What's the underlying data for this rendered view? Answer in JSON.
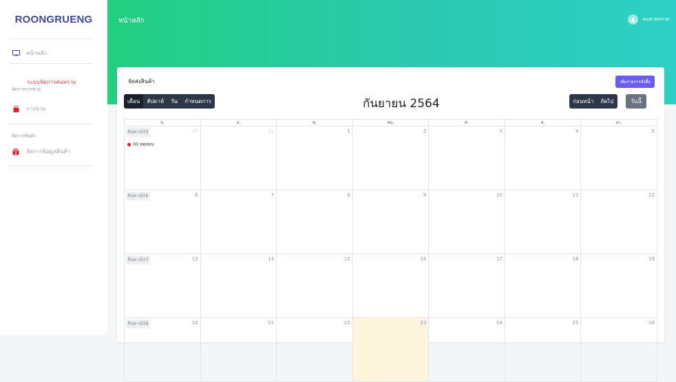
{
  "sidebar": {
    "brand": "ROONGRUENG",
    "home_label": "หน้าหลัก",
    "system_label": "ระบบจัดการสนทราย",
    "section_sales": "จัดการการขาย",
    "sales_item": "การขาย",
    "section_products": "จัดการสินค้า",
    "product_item": "จัดการข้อมูลสินค้า"
  },
  "topbar": {
    "title": "หน้าหลัก",
    "user_name": "คนขายทราย"
  },
  "card": {
    "title": "จัดส่งสินค้า",
    "add_order_label": "เพิ่มรายการสั่งซื้อ"
  },
  "calendar": {
    "title": "กันยายน 2564",
    "views": [
      "เดือน",
      "สัปดาห์",
      "วัน",
      "กำหนดการ"
    ],
    "prev_label": "ก่อนหน้า",
    "next_label": "ถัดไป",
    "today_label": "วันนี้",
    "weekdays": [
      "จ.",
      "อ.",
      "พ.",
      "พฤ.",
      "ศ.",
      "ส.",
      "อา."
    ],
    "weeks": [
      {
        "label": "สัปดาห์35",
        "days": [
          "30",
          "31",
          "1",
          "2",
          "3",
          "4",
          "5"
        ]
      },
      {
        "label": "สัปดาห์36",
        "days": [
          "6",
          "7",
          "8",
          "9",
          "10",
          "11",
          "12"
        ]
      },
      {
        "label": "สัปดาห์37",
        "days": [
          "13",
          "14",
          "15",
          "16",
          "17",
          "18",
          "19"
        ]
      },
      {
        "label": "สัปดาห์38",
        "days": [
          "20",
          "21",
          "22",
          "23",
          "24",
          "25",
          "26"
        ]
      }
    ],
    "event": {
      "time": "00",
      "text": "ทดสอบ"
    }
  },
  "colors": {
    "accent_green": "#22cf80",
    "accent_teal": "#2ed0c6",
    "brand": "#3b4a9b",
    "button_purple": "#6a5cf0",
    "event_dot": "#e11d2e",
    "today_bg": "#fdf6dc"
  }
}
